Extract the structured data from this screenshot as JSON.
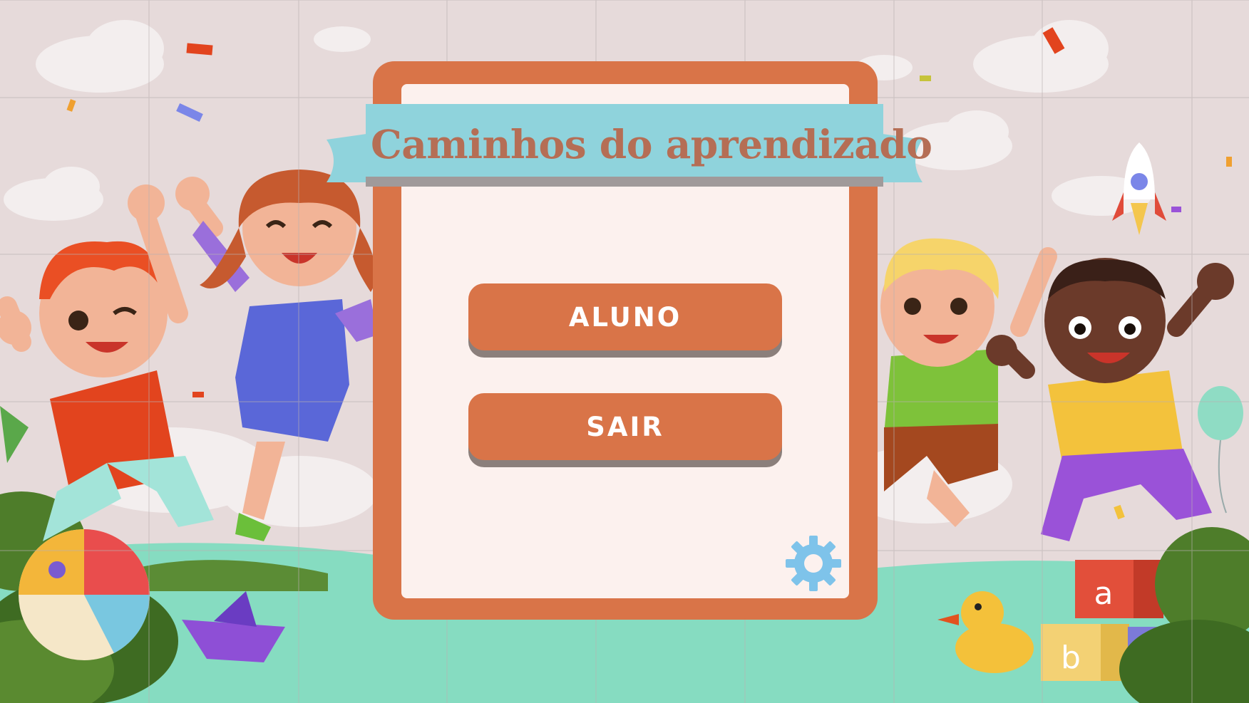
{
  "game": {
    "title": "Caminhos do aprendizado",
    "buttons": {
      "student_label": "ALUNO",
      "exit_label": "SAIR"
    },
    "settings_icon": "gear-icon",
    "blocks": {
      "block_a": "a",
      "block_b": "b"
    }
  },
  "colors": {
    "panel_accent": "#d97448",
    "panel_inner": "#fcf1ee",
    "ribbon": "#8fd3dc",
    "title_text": "#b56e55",
    "gear": "#7ec3ea",
    "ground": "#86dcc1"
  }
}
